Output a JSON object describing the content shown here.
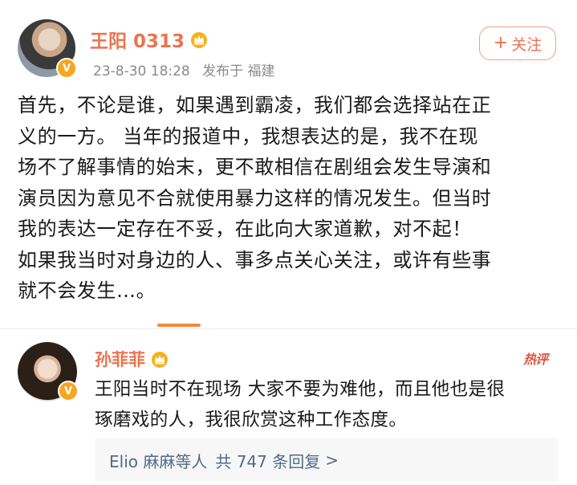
{
  "post": {
    "author": {
      "name": "王阳 0313",
      "verified_badge": "V"
    },
    "meta": {
      "time": "23-8-30 18:28",
      "source": "发布于 福建"
    },
    "follow_button": {
      "icon": "plus-icon",
      "label": "关注"
    },
    "content_lines": [
      "首先，不论是谁，如果遇到霸凌，我们都会选择站在正",
      "义的一方。  当年的报道中，我想表达的是，我不在现",
      "场不了解事情的始末，更不敢相信在剧组会发生导演和",
      "演员因为意见不合就使用暴力这样的情况发生。但当时",
      "我的表达一定存在不妥，在此向大家道歉，对不起！",
      "  如果我当时对身边的人、事多点关心关注，或许有些事",
      "就不会发生…。"
    ]
  },
  "comment": {
    "author": {
      "name": "孙菲菲",
      "verified_badge": "V"
    },
    "hot_label": "热评",
    "text_lines": [
      "王阳当时不在现场 大家不要为难他，而且他也是很",
      "琢磨戏的人，我很欣赏这种工作态度。"
    ],
    "replies": {
      "who": "Elio 麻麻等人",
      "count_text": "共 747 条回复",
      "arrow": ">"
    }
  },
  "colors": {
    "accent": "#eb7350",
    "link": "#4f6b8a",
    "tab_indicator": "#f08a3c"
  }
}
